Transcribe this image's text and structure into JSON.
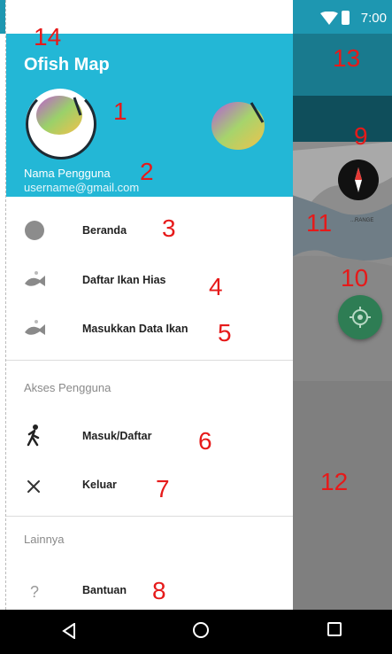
{
  "status": {
    "time": "7:00"
  },
  "drawer": {
    "title": "Ofish Map",
    "user_name": "Nama Pengguna",
    "user_email": "username@gmail.com",
    "items": [
      {
        "label": "Beranda",
        "icon": "circle-icon"
      },
      {
        "label": "Daftar Ikan Hias",
        "icon": "fish-icon"
      },
      {
        "label": "Masukkan Data Ikan",
        "icon": "fish-icon"
      }
    ],
    "section_access": "Akses Pengguna",
    "access_items": [
      {
        "label": "Masuk/Daftar",
        "icon": "walking-person-icon"
      },
      {
        "label": "Keluar",
        "icon": "close-icon"
      }
    ],
    "section_other": "Lainnya",
    "other_items": [
      {
        "label": "Bantuan",
        "icon": "question-icon"
      }
    ]
  },
  "map": {
    "place_label": "...RANGE"
  },
  "annotations": [
    "1",
    "2",
    "3",
    "4",
    "5",
    "6",
    "7",
    "8",
    "9",
    "10",
    "11",
    "12",
    "13",
    "14"
  ],
  "colors": {
    "header": "#23b7d6",
    "status_bar": "#1e97b1",
    "appbar_dark": "#0f4e5b",
    "locate_button": "#2e7d54",
    "annotation": "#e61a1a"
  }
}
